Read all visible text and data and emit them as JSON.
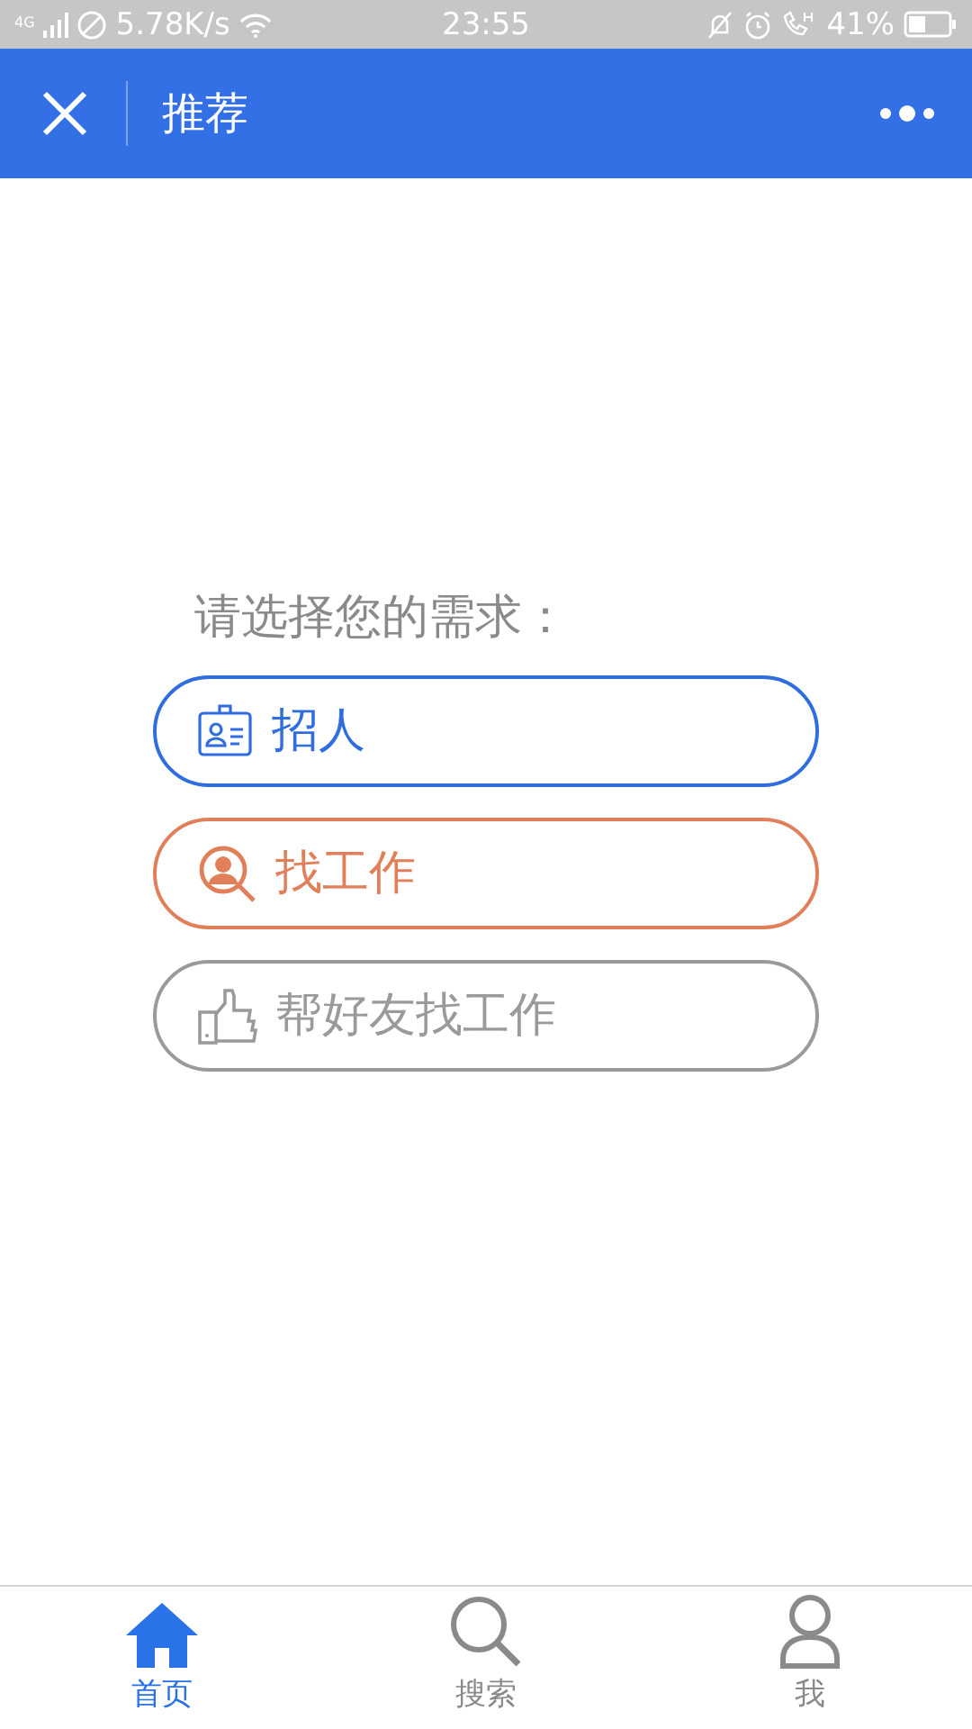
{
  "status_bar": {
    "network": "4G",
    "speed": "5.78K/s",
    "time": "23:55",
    "battery": "41%"
  },
  "nav": {
    "title": "推荐"
  },
  "prompt": "请选择您的需求：",
  "options": [
    {
      "kind": "recruit",
      "label": "招人",
      "color": "#2f6de1"
    },
    {
      "kind": "job",
      "label": "找工作",
      "color": "#e07f5a"
    },
    {
      "kind": "friend",
      "label": "帮好友找工作",
      "color": "#9a9a9a"
    }
  ],
  "tabs": [
    {
      "kind": "home",
      "label": "首页",
      "selected": true
    },
    {
      "kind": "search",
      "label": "搜索",
      "selected": false
    },
    {
      "kind": "me",
      "label": "我",
      "selected": false
    }
  ]
}
